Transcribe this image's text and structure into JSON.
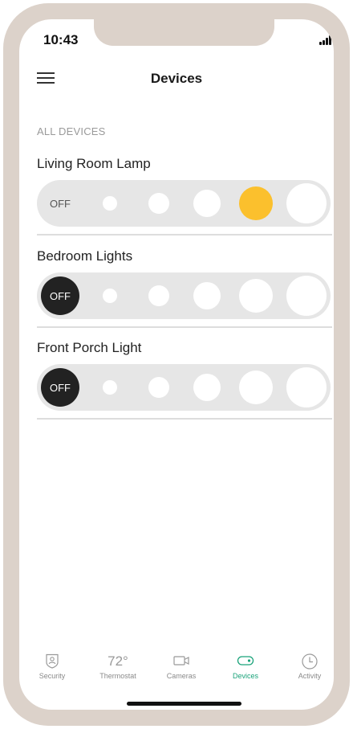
{
  "status_bar": {
    "time": "10:43"
  },
  "header": {
    "title": "Devices"
  },
  "section": {
    "label": "ALL DEVICES"
  },
  "devices": [
    {
      "name": "Living Room Lamp",
      "off_label": "OFF",
      "level": 4,
      "max_level": 5,
      "state": "on",
      "active_color": "#fbc02d"
    },
    {
      "name": "Bedroom Lights",
      "off_label": "OFF",
      "level": 0,
      "max_level": 5,
      "state": "off"
    },
    {
      "name": "Front Porch Light",
      "off_label": "OFF",
      "level": 0,
      "max_level": 5,
      "state": "off"
    }
  ],
  "tabbar": {
    "accent": "#1aa37a",
    "tabs": [
      {
        "label": "Security",
        "icon": "shield-person-icon"
      },
      {
        "label": "Thermostat",
        "icon": "temperature-readout",
        "value": "72°"
      },
      {
        "label": "Cameras",
        "icon": "camera-icon"
      },
      {
        "label": "Devices",
        "icon": "toggle-icon",
        "active": true
      },
      {
        "label": "Activity",
        "icon": "clock-icon"
      }
    ]
  }
}
